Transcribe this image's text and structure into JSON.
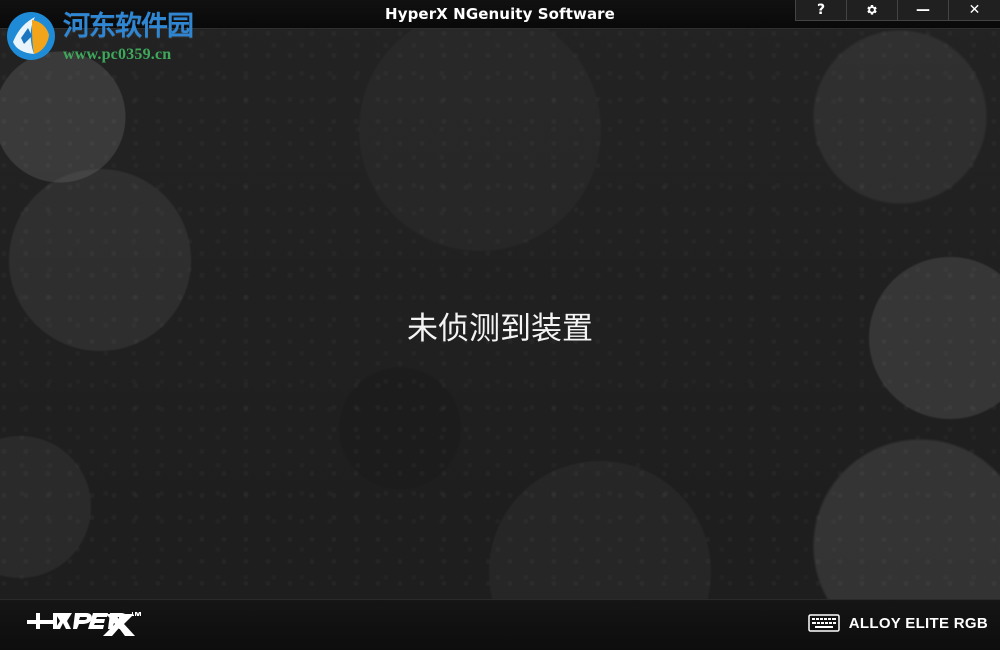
{
  "window": {
    "title": "HyperX NGenuity Software"
  },
  "controls": {
    "help_glyph": "?",
    "minimize_glyph": "—",
    "close_glyph": "✕",
    "settings_icon": "gear-icon"
  },
  "watermark": {
    "title": "河东软件园",
    "url": "www.pc0359.cn"
  },
  "main": {
    "message": "未侦测到装置"
  },
  "footer": {
    "brand_logo": "hyperx-logo",
    "device_icon": "keyboard-icon",
    "device_name": "ALLOY ELITE RGB"
  }
}
